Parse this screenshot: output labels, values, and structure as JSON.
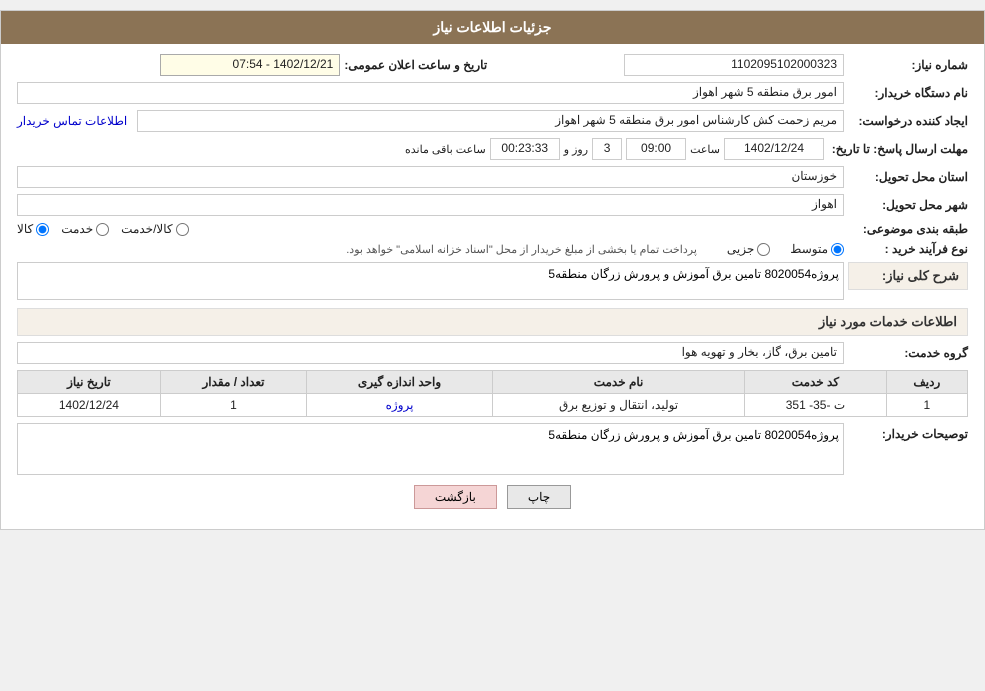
{
  "page": {
    "title": "جزئیات اطلاعات نیاز"
  },
  "fields": {
    "shomareNiaz_label": "شماره نیاز:",
    "shomareNiaz_value": "1102095102000323",
    "namDastgah_label": "نام دستگاه خریدار:",
    "namDastgah_value": "امور برق منطقه 5 شهر اهواز",
    "tarikh_label": "تاریخ و ساعت اعلان عمومی:",
    "tarikh_value": "1402/12/21 - 07:54",
    "ijadKonande_label": "ایجاد کننده درخواست:",
    "ijadKonande_value": "مریم زحمت کش کارشناس امور برق منطقه 5 شهر اهواز",
    "ijadKonande_link": "اطلاعات تماس خریدار",
    "mohlatErsal_label": "مهلت ارسال پاسخ: تا تاریخ:",
    "mohlatDate": "1402/12/24",
    "mohlatSaat_label": "ساعت",
    "mohlatSaat": "09:00",
    "mohlatRoz_label": "روز و",
    "mohlatRoz": "3",
    "mohlatBaqi_label": "ساعت باقی مانده",
    "mohlatBaqi": "00:23:33",
    "ostan_label": "استان محل تحویل:",
    "ostan_value": "خوزستان",
    "shahr_label": "شهر محل تحویل:",
    "shahr_value": "اهواز",
    "tabaqeBandi_label": "طبقه بندی موضوعی:",
    "tabaqe_options": [
      "کالا",
      "خدمت",
      "کالا/خدمت"
    ],
    "tabaqe_selected": "کالا",
    "noFarayand_label": "نوع فرآیند خرید :",
    "farayand_options": [
      "جزیی",
      "متوسط"
    ],
    "farayand_selected": "متوسط",
    "farayand_note": "پرداخت تمام یا بخشی از مبلغ خریدار از محل \"اسناد خزانه اسلامی\" خواهد بود.",
    "sharhKoli_label": "شرح کلی نیاز:",
    "sharhKoli_value": "پروژه8020054 تامین برق آموزش و پرورش زرگان منطقه5",
    "serviceInfo_title": "اطلاعات خدمات مورد نیاز",
    "grouhKhadmat_label": "گروه خدمت:",
    "grouhKhadmat_value": "تامین برق، گاز، بخار و تهویه هوا",
    "table": {
      "headers": [
        "ردیف",
        "کد خدمت",
        "نام خدمت",
        "واحد اندازه گیری",
        "تعداد / مقدار",
        "تاریخ نیاز"
      ],
      "rows": [
        [
          "1",
          "ت -35- 351",
          "تولید، انتقال و توزیع برق",
          "پروژه",
          "1",
          "1402/12/24"
        ]
      ]
    },
    "tosihKharidar_label": "توصیحات خریدار:",
    "tosihKharidar_value": "پروژه8020054 تامین برق آموزش و پرورش زرگان منطقه5",
    "btn_print": "چاپ",
    "btn_back": "بازگشت"
  }
}
